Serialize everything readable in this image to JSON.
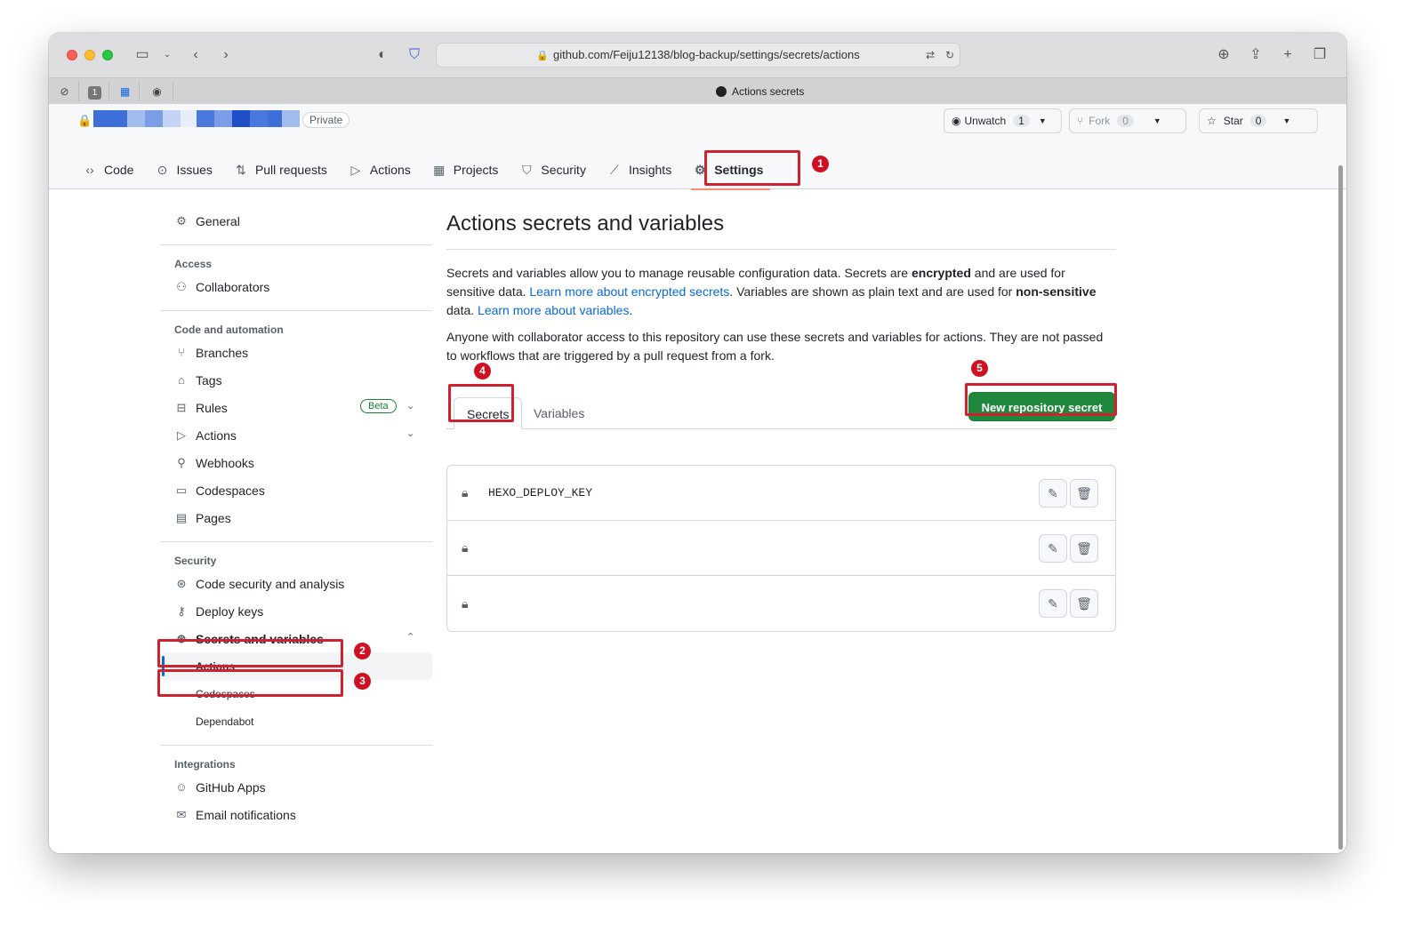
{
  "browser": {
    "url": "github.com/Feiju12138/blog-backup/settings/secrets/actions",
    "tab_title": "Actions secrets",
    "pinned_tab_badge": "1"
  },
  "repo": {
    "visibility": "Private",
    "watch": {
      "label": "Unwatch",
      "count": "1"
    },
    "fork": {
      "label": "Fork",
      "count": "0"
    },
    "star": {
      "label": "Star",
      "count": "0"
    }
  },
  "nav": [
    {
      "label": "Code",
      "icon": "code-icon"
    },
    {
      "label": "Issues",
      "icon": "issue-icon"
    },
    {
      "label": "Pull requests",
      "icon": "pull-request-icon"
    },
    {
      "label": "Actions",
      "icon": "play-icon"
    },
    {
      "label": "Projects",
      "icon": "table-icon"
    },
    {
      "label": "Security",
      "icon": "shield-icon"
    },
    {
      "label": "Insights",
      "icon": "graph-icon"
    },
    {
      "label": "Settings",
      "icon": "gear-icon"
    }
  ],
  "sidebar": {
    "general": "General",
    "access_heading": "Access",
    "collaborators": "Collaborators",
    "code_heading": "Code and automation",
    "branches": "Branches",
    "tags": "Tags",
    "rules": "Rules",
    "rules_badge": "Beta",
    "actions": "Actions",
    "webhooks": "Webhooks",
    "codespaces": "Codespaces",
    "pages": "Pages",
    "security_heading": "Security",
    "code_security": "Code security and analysis",
    "deploy_keys": "Deploy keys",
    "secrets_vars": "Secrets and variables",
    "sub_actions": "Actions",
    "sub_codespaces": "Codespaces",
    "sub_dependabot": "Dependabot",
    "integrations_heading": "Integrations",
    "github_apps": "GitHub Apps",
    "email_notifications": "Email notifications"
  },
  "main": {
    "title": "Actions secrets and variables",
    "p1_a": "Secrets and variables allow you to manage reusable configuration data. Secrets are ",
    "p1_b": "encrypted",
    "p1_c": " and are used for sensitive data. ",
    "p1_link1": "Learn more about encrypted secrets",
    "p1_d": ". Variables are shown as plain text and are used for ",
    "p1_e": "non-sensitive",
    "p1_f": " data. ",
    "p1_link2": "Learn more about variables",
    "p1_g": ".",
    "p2": "Anyone with collaborator access to this repository can use these secrets and variables for actions. They are not passed to workflows that are triggered by a pull request from a fork.",
    "tab_secrets": "Secrets",
    "tab_variables": "Variables",
    "new_secret": "New repository secret",
    "secrets": [
      {
        "name": "HEXO_DEPLOY_KEY"
      },
      {
        "name": ""
      },
      {
        "name": ""
      }
    ]
  },
  "annotations": [
    "1",
    "2",
    "3",
    "4",
    "5"
  ],
  "colors": {
    "accent": "#1f883d",
    "highlight": "#cf222e",
    "link": "#0969da"
  }
}
